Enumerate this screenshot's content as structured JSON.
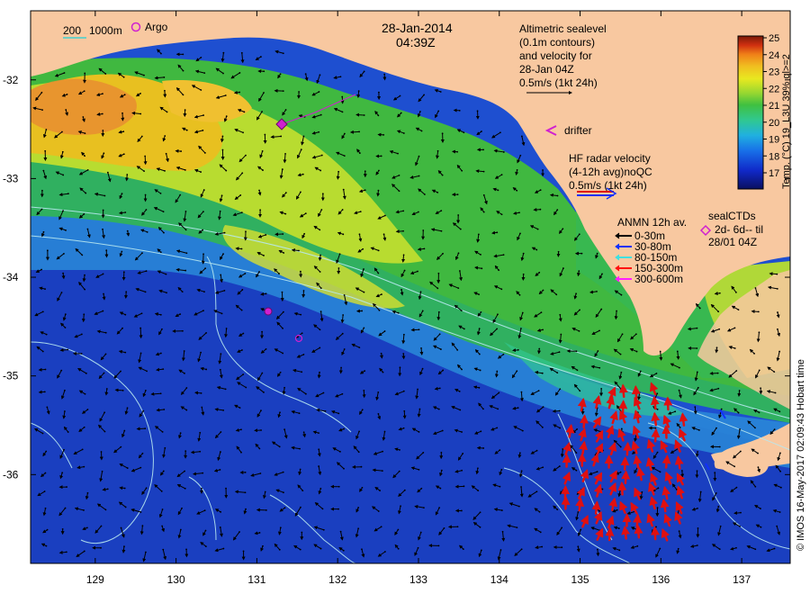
{
  "title": {
    "date": "28-Jan-2014",
    "time": "04:39Z"
  },
  "isobath_legend": {
    "depth1": "200",
    "depth2": "1000m"
  },
  "argo_label": "Argo",
  "altimetry": {
    "lines": [
      "Altimetric sealevel",
      "(0.1m contours)",
      "and velocity for",
      "28-Jan 04Z",
      "0.5m/s (1kt 24h)"
    ]
  },
  "drifter_label": "drifter",
  "hf_radar": {
    "lines": [
      "HF radar velocity",
      "(4-12h avg)noQC",
      "0.5m/s (1kt 24h)"
    ]
  },
  "anmn": {
    "title": "ANMN 12h av.",
    "items": [
      {
        "label": "0-30m",
        "color": "#000000"
      },
      {
        "label": "30-80m",
        "color": "#1030ff"
      },
      {
        "label": "80-150m",
        "color": "#40e0e0"
      },
      {
        "label": "150-300m",
        "color": "#ff1010"
      },
      {
        "label": "300-600m",
        "color": "#ff20ff"
      }
    ]
  },
  "seal_ctds": {
    "lines": [
      "sealCTDs",
      "2d- 6d-- til",
      "28/01 04Z"
    ]
  },
  "colorbar": {
    "ticks": [
      "17",
      "18",
      "19",
      "20",
      "21",
      "22",
      "23",
      "24",
      "25"
    ],
    "label": "Temp. (°C) 19_L3U 39% ql>=2",
    "colors": [
      "#0a1060",
      "#1028c8",
      "#1870e8",
      "#20b0e0",
      "#30c890",
      "#40c040",
      "#9ad830",
      "#e8e820",
      "#f0c020",
      "#f08018",
      "#d03010",
      "#7a1a08"
    ]
  },
  "credit": "© IMOS 16-May-2017 02:09:43 Hobart time",
  "axes": {
    "lat_ticks": [
      "-32",
      "-33",
      "-34",
      "-35",
      "-36"
    ],
    "lon_ticks": [
      "129",
      "130",
      "131",
      "132",
      "133",
      "134",
      "135",
      "136",
      "137"
    ],
    "lat_values": [
      -32,
      -33,
      -34,
      -35,
      -36
    ],
    "lon_values": [
      129,
      130,
      131,
      132,
      133,
      134,
      135,
      136,
      137
    ],
    "lon_range": [
      128.2,
      137.6
    ],
    "lat_range": [
      -31.3,
      -36.9
    ]
  },
  "colors": {
    "land": "#f8c8a0",
    "argo": "#d020d0",
    "radar_arrow": "#e01010",
    "contour": "#b8e8f0"
  }
}
